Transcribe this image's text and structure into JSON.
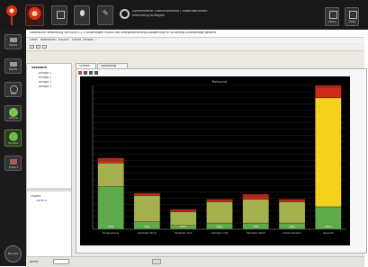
{
  "top_bar": {
    "title_line1": "Systemname / Benutzername / Inbetriebnahme",
    "title_line2": "Monitoring Anzeigen",
    "right_buttons": [
      {
        "label": "Menü"
      },
      {
        "label": "Hilfe"
      }
    ]
  },
  "left_toolbar": {
    "buttons": [
      {
        "label": "Werkz."
      },
      {
        "label": "Werkz."
      },
      {
        "label": "Netz"
      },
      {
        "label": "Online"
      },
      {
        "label": "Monitor"
      },
      {
        "label": "Export"
      }
    ],
    "bottom_button": {
      "label": "Beenden"
    }
  },
  "window": {
    "title": "Lebenslinie Verbindung  VERSION 1.2.5 Änderungen  HORIZONS Energieverteilung Auswertung für Sicherung  Schaltanlage gesamt",
    "menu": [
      "Datei",
      "Bearbeiten",
      "Ansicht",
      "Extras",
      "Fenster",
      "?"
    ]
  },
  "tree": {
    "root": "Netzwerk",
    "items": [
      "Anlage 1",
      "Anlage 2",
      "Anlage 3",
      "Anlage 4"
    ],
    "lower_items": [
      "Projekt",
      "Gerät A"
    ]
  },
  "tabs": [
    "Symbol",
    "Monitoring"
  ],
  "chart_data": {
    "type": "bar",
    "title": "Belegung",
    "categories": [
      "Einspeisung",
      "Verteiler Nord",
      "Verteiler Süd",
      "Verteiler Ost",
      "Verteiler West",
      "Unterverteiler",
      "Gesamt"
    ],
    "value_labels": [
      "59%",
      "35%",
      "20%",
      "28%",
      "34%",
      "28%",
      "100%"
    ],
    "series": [
      {
        "color": "#5faa4a",
        "values": [
          34,
          6,
          3,
          5,
          5,
          5,
          18
        ]
      },
      {
        "color": "#a5b04e",
        "values": [
          19,
          21,
          11,
          17,
          19,
          17,
          0
        ]
      },
      {
        "color": "#f2d21a",
        "values": [
          0,
          0,
          0,
          0,
          0,
          0,
          87
        ]
      },
      {
        "color": "#cc2a1c",
        "values": [
          4,
          2,
          2,
          2,
          4,
          2,
          10
        ]
      }
    ],
    "ylim": [
      0,
      115
    ],
    "grid": true
  },
  "status": {
    "text": "Bereit"
  }
}
